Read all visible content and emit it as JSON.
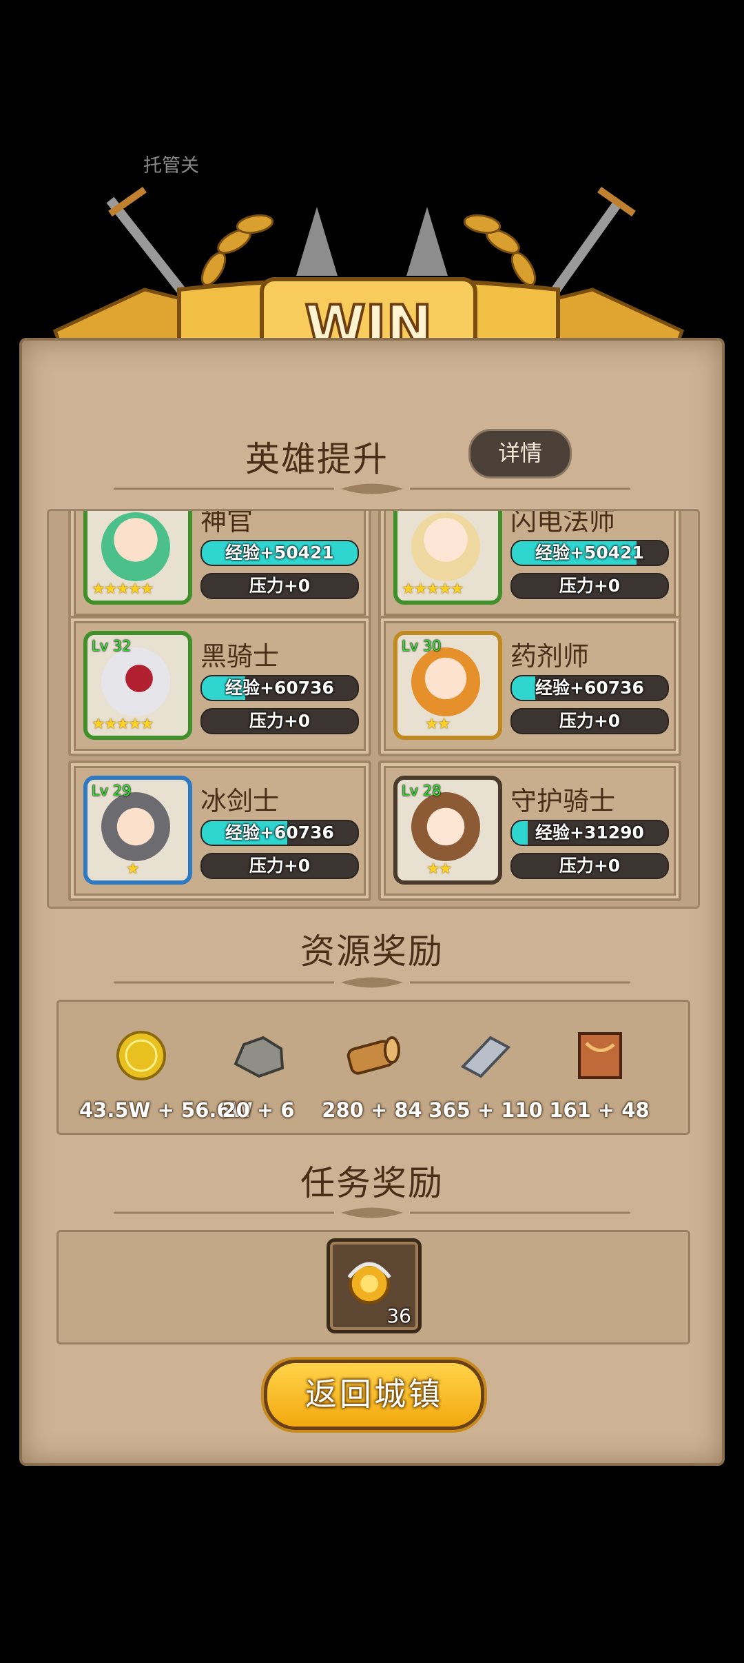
{
  "header": {
    "label": "托管关",
    "banner_text": "WIN"
  },
  "hero_section": {
    "title": "英雄提升",
    "details_label": "详情",
    "heroes": [
      {
        "name": "神官",
        "level": "",
        "stars": "★★★★★",
        "exp": "经验+50421",
        "exp_fill": 1.0,
        "pressure": "压力+0"
      },
      {
        "name": "闪电法师",
        "level": "",
        "stars": "★★★★★",
        "exp": "经验+50421",
        "exp_fill": 0.8,
        "pressure": "压力+0"
      },
      {
        "name": "黑骑士",
        "level": "Lv 32",
        "stars": "★★★★★",
        "exp": "经验+60736",
        "exp_fill": 0.28,
        "pressure": "压力+0"
      },
      {
        "name": "药剂师",
        "level": "Lv 30",
        "stars": "★★",
        "exp": "经验+60736",
        "exp_fill": 0.15,
        "pressure": "压力+0"
      },
      {
        "name": "冰剑士",
        "level": "Lv 29",
        "stars": "★",
        "exp": "经验+60736",
        "exp_fill": 0.55,
        "pressure": "压力+0"
      },
      {
        "name": "守护骑士",
        "level": "Lv 28",
        "stars": "★★",
        "exp": "经验+31290",
        "exp_fill": 0.1,
        "pressure": "压力+0"
      }
    ]
  },
  "resource_section": {
    "title": "资源奖励",
    "items": [
      {
        "icon": "gold-coin-icon",
        "value": "43.5W + 56.6W"
      },
      {
        "icon": "stone-icon",
        "value": "20 + 6"
      },
      {
        "icon": "wood-log-icon",
        "value": "280 + 84"
      },
      {
        "icon": "iron-ingot-icon",
        "value": "365 + 110"
      },
      {
        "icon": "cloth-icon",
        "value": "161 + 48"
      }
    ]
  },
  "task_section": {
    "title": "任务奖励",
    "item": {
      "icon": "medal-icon",
      "count": "36"
    }
  },
  "return_button": "返回城镇",
  "colors": {
    "exp_bar": "#2fd6d0",
    "panel": "#cdb394",
    "button": "#f2a90f"
  }
}
